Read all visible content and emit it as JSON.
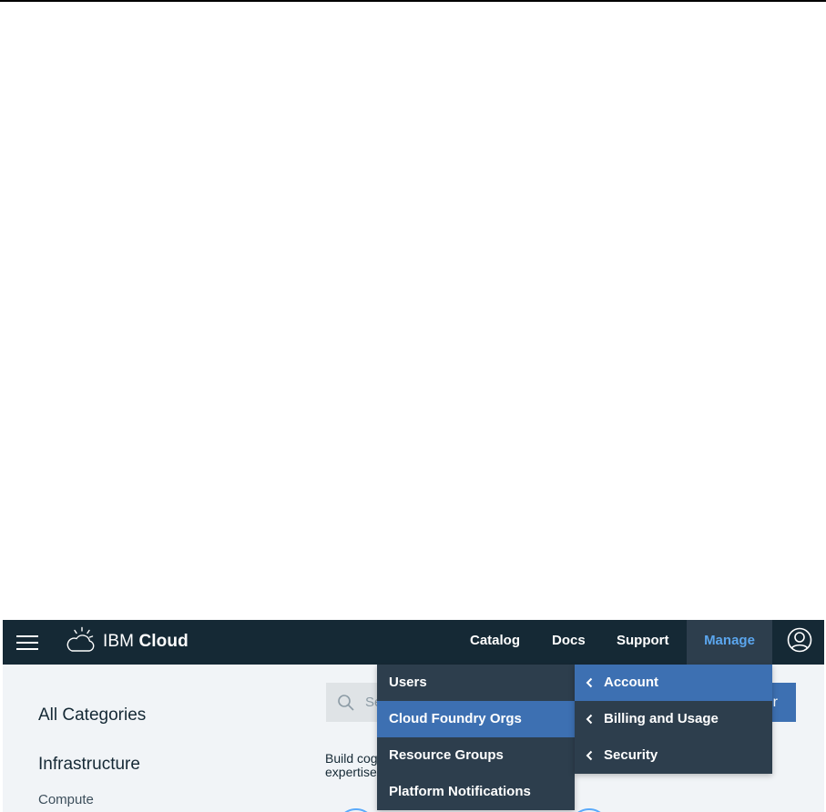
{
  "navbar": {
    "brand_prefix": "IBM",
    "brand_name": "Cloud",
    "links": {
      "catalog": "Catalog",
      "docs": "Docs",
      "support": "Support",
      "manage": "Manage"
    }
  },
  "manage_menu": {
    "items": [
      "Users",
      "Cloud Foundry Orgs",
      "Resource Groups",
      "Platform Notifications"
    ],
    "active_item": "Cloud Foundry Orgs"
  },
  "account_submenu": {
    "items": [
      "Account",
      "Billing and Usage",
      "Security"
    ],
    "active_item": "Account"
  },
  "sidebar": {
    "all_categories": "All Categories",
    "infrastructure": "Infrastructure",
    "compute": "Compute"
  },
  "search": {
    "placeholder_visible": "Se"
  },
  "create_button": {
    "visible_label": "r"
  },
  "blurb": {
    "line1": "Build cog",
    "line2": "expertise"
  },
  "colors": {
    "navbar": "#152935",
    "menu": "#2d3e4d",
    "active": "#3d70b2",
    "manage_text": "#5ba6ee"
  },
  "icons": {
    "menu": "hamburger-icon",
    "logo": "ibm-cloud-logo-icon",
    "user": "user-avatar-icon",
    "search": "search-icon",
    "chevron": "chevron-left-icon"
  }
}
